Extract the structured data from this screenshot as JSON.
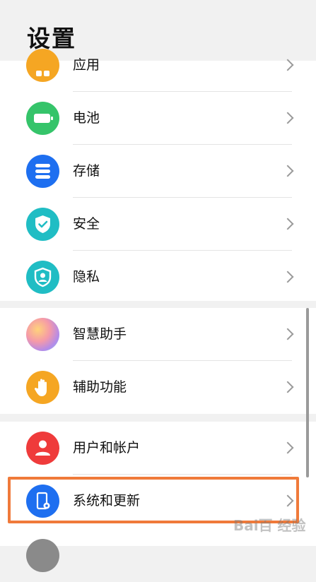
{
  "header": {
    "title": "设置"
  },
  "groups": [
    {
      "items": [
        {
          "label": "应用",
          "icon": "apps-icon",
          "color": "#f5a623"
        },
        {
          "label": "电池",
          "icon": "battery-icon",
          "color": "#35c46a"
        },
        {
          "label": "存储",
          "icon": "storage-icon",
          "color": "#1e6ff0"
        },
        {
          "label": "安全",
          "icon": "security-shield-icon",
          "color": "#20bdc4"
        },
        {
          "label": "隐私",
          "icon": "privacy-icon",
          "color": "#20bdc4"
        }
      ]
    },
    {
      "items": [
        {
          "label": "智慧助手",
          "icon": "smart-assistant-icon",
          "color": "#d08ee6"
        },
        {
          "label": "辅助功能",
          "icon": "accessibility-hand-icon",
          "color": "#f5a623"
        }
      ]
    },
    {
      "items": [
        {
          "label": "用户和帐户",
          "icon": "user-icon",
          "color": "#ef3b3b"
        },
        {
          "label": "系统和更新",
          "icon": "system-update-icon",
          "color": "#1e6ff0"
        }
      ]
    }
  ],
  "watermark": "Bai百 经验"
}
